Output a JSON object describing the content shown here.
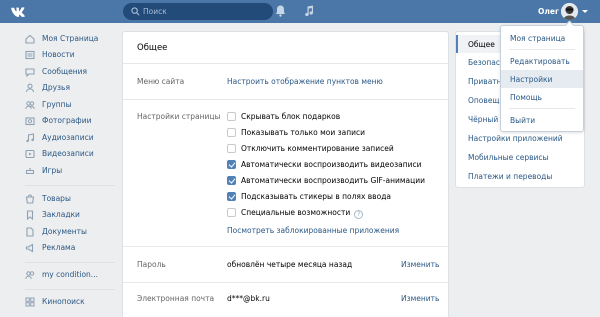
{
  "header": {
    "logo_icon": "vk-logo-icon",
    "search_placeholder": "Поиск",
    "user_name": "Олег"
  },
  "left_menu": {
    "items": [
      {
        "label": "Моя Страница",
        "icon": "home-icon"
      },
      {
        "label": "Новости",
        "icon": "news-icon"
      },
      {
        "label": "Сообщения",
        "icon": "messages-icon"
      },
      {
        "label": "Друзья",
        "icon": "friends-icon"
      },
      {
        "label": "Группы",
        "icon": "groups-icon"
      },
      {
        "label": "Фотографии",
        "icon": "photos-icon"
      },
      {
        "label": "Аудиозаписи",
        "icon": "audio-icon"
      },
      {
        "label": "Видеозаписи",
        "icon": "video-icon"
      },
      {
        "label": "Игры",
        "icon": "games-icon"
      },
      {
        "label": "Товары",
        "icon": "market-icon"
      },
      {
        "label": "Закладки",
        "icon": "bookmarks-icon"
      },
      {
        "label": "Документы",
        "icon": "documents-icon"
      },
      {
        "label": "Реклама",
        "icon": "ads-icon"
      },
      {
        "label": "my condition...",
        "icon": "community-icon"
      },
      {
        "label": "Кинопоиск",
        "icon": "app-icon"
      }
    ]
  },
  "settings": {
    "title": "Общее",
    "menu_label": "Меню сайта",
    "menu_link": "Настроить отображение пунктов меню",
    "page_settings_label": "Настройки страницы",
    "options": [
      {
        "label": "Скрывать блок подарков",
        "checked": false
      },
      {
        "label": "Показывать только мои записи",
        "checked": false
      },
      {
        "label": "Отключить комментирование записей",
        "checked": false
      },
      {
        "label": "Автоматически воспроизводить видеозаписи",
        "checked": true
      },
      {
        "label": "Автоматически воспроизводить GIF-анимации",
        "checked": true
      },
      {
        "label": "Подсказывать стикеры в полях ввода",
        "checked": true
      },
      {
        "label": "Специальные возможности",
        "checked": false
      }
    ],
    "help_mark": "?",
    "blocked_apps_link": "Посмотреть заблокированные приложения",
    "password_label": "Пароль",
    "password_value": "обновлён четыре месяца назад",
    "password_change": "Изменить",
    "email_label": "Электронная почта",
    "email_value": "d***@bk.ru",
    "email_change": "Изменить"
  },
  "right_nav": {
    "items": [
      "Общее",
      "Безопасн",
      "Приватн",
      "Оповеще",
      "Чёрный с",
      "Настройки приложений",
      "Мобильные сервисы",
      "Платежи и переводы"
    ]
  },
  "dropdown": {
    "items": [
      "Моя страница",
      "Редактировать",
      "Настройки",
      "Помощь",
      "Выйти"
    ]
  },
  "colors": {
    "header": "#4a76a8",
    "link": "#2a5885",
    "checkbox_on": "#5181b8",
    "background": "#edeef0"
  }
}
